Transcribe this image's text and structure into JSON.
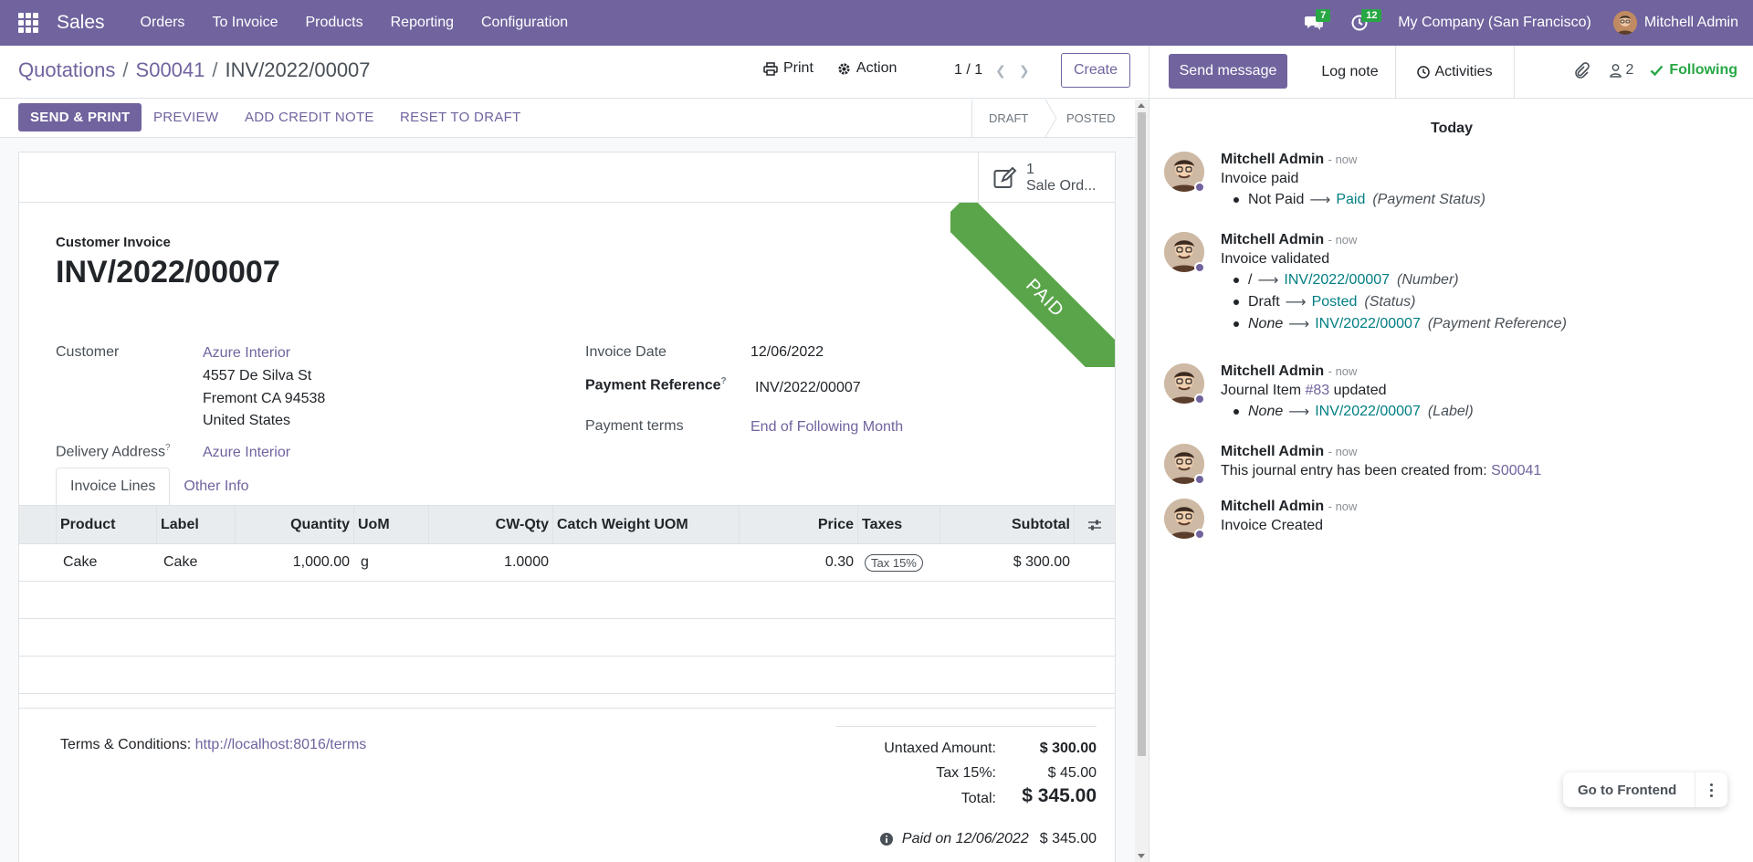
{
  "navbar": {
    "brand": "Sales",
    "menu": [
      "Orders",
      "To Invoice",
      "Products",
      "Reporting",
      "Configuration"
    ],
    "messages_count": "7",
    "activities_count": "12",
    "company": "My Company (San Francisco)",
    "user": "Mitchell Admin",
    "icons": [
      "apps-icon",
      "chat-icon",
      "clock-icon"
    ]
  },
  "control_panel": {
    "breadcrumb": [
      "Quotations",
      "S00041",
      "INV/2022/00007"
    ],
    "print_label": "Print",
    "action_label": "Action",
    "pager": "1 / 1",
    "create_label": "Create"
  },
  "status_bar": {
    "buttons": [
      "SEND & PRINT",
      "PREVIEW",
      "ADD CREDIT NOTE",
      "RESET TO DRAFT"
    ],
    "stages": [
      "DRAFT",
      "POSTED"
    ],
    "current_stage": "POSTED"
  },
  "smart_button": {
    "count": "1",
    "label": "Sale Ord..."
  },
  "ribbon": "PAID",
  "invoice": {
    "subtitle": "Customer Invoice",
    "number": "INV/2022/00007",
    "customer_label": "Customer",
    "customer_name": "Azure Interior",
    "address": [
      "4557 De Silva St",
      "Fremont CA 94538",
      "United States"
    ],
    "delivery_label": "Delivery Address",
    "delivery_value": "Azure Interior",
    "invoice_date_label": "Invoice Date",
    "invoice_date": "12/06/2022",
    "payment_ref_label": "Payment Reference",
    "payment_ref": "INV/2022/00007",
    "payment_terms_label": "Payment terms",
    "payment_terms": "End of Following Month",
    "help_mark": "?"
  },
  "tabs": [
    "Invoice Lines",
    "Other Info"
  ],
  "lines": {
    "headers": [
      "Product",
      "Label",
      "Quantity",
      "UoM",
      "CW-Qty",
      "Catch Weight UOM",
      "Price",
      "Taxes",
      "Subtotal"
    ],
    "rows": [
      {
        "product": "Cake",
        "label": "Cake",
        "quantity": "1,000.00",
        "uom": "g",
        "cw_qty": "1.0000",
        "cw_uom": "",
        "price": "0.30",
        "taxes": "Tax 15%",
        "subtotal": "$ 300.00"
      }
    ]
  },
  "footer": {
    "terms_label": "Terms & Conditions:",
    "terms_link": "http://localhost:8016/terms",
    "untaxed_label": "Untaxed Amount:",
    "untaxed": "$ 300.00",
    "tax_label": "Tax 15%:",
    "tax": "$ 45.00",
    "total_label": "Total:",
    "total": "$ 345.00",
    "paid_on": "Paid on 12/06/2022",
    "paid_amount": "$ 345.00"
  },
  "chatter": {
    "send_message": "Send message",
    "log_note": "Log note",
    "activities": "Activities",
    "followers": "2",
    "following": "Following",
    "day": "Today",
    "messages": [
      {
        "author": "Mitchell Admin",
        "when": "- now",
        "text": "Invoice paid",
        "changes": [
          {
            "old": "Not Paid",
            "new": "Paid",
            "field": "(Payment Status)"
          }
        ]
      },
      {
        "author": "Mitchell Admin",
        "when": "- now",
        "text": "Invoice validated",
        "changes": [
          {
            "old": "/",
            "new": "INV/2022/00007",
            "field": "(Number)"
          },
          {
            "old": "Draft",
            "new": "Posted",
            "field": "(Status)"
          },
          {
            "old": "None",
            "new": "INV/2022/00007",
            "field": "(Payment Reference)"
          }
        ]
      },
      {
        "author": "Mitchell Admin",
        "when": "- now",
        "text_prefix": "Journal Item",
        "text_link": "#83",
        "text_suffix": "updated",
        "changes": [
          {
            "old": "None",
            "new": "INV/2022/00007",
            "field": "(Label)"
          }
        ]
      },
      {
        "author": "Mitchell Admin",
        "when": "- now",
        "text_prefix": "This journal entry has been created from:",
        "text_link": "S00041"
      },
      {
        "author": "Mitchell Admin",
        "when": "- now",
        "text": "Invoice Created"
      }
    ]
  },
  "go_frontend": "Go to Frontend",
  "colors": {
    "brand": "#71639e",
    "paid_ribbon": "#5aa54a",
    "following": "#28a745",
    "change_link": "#017e84"
  }
}
